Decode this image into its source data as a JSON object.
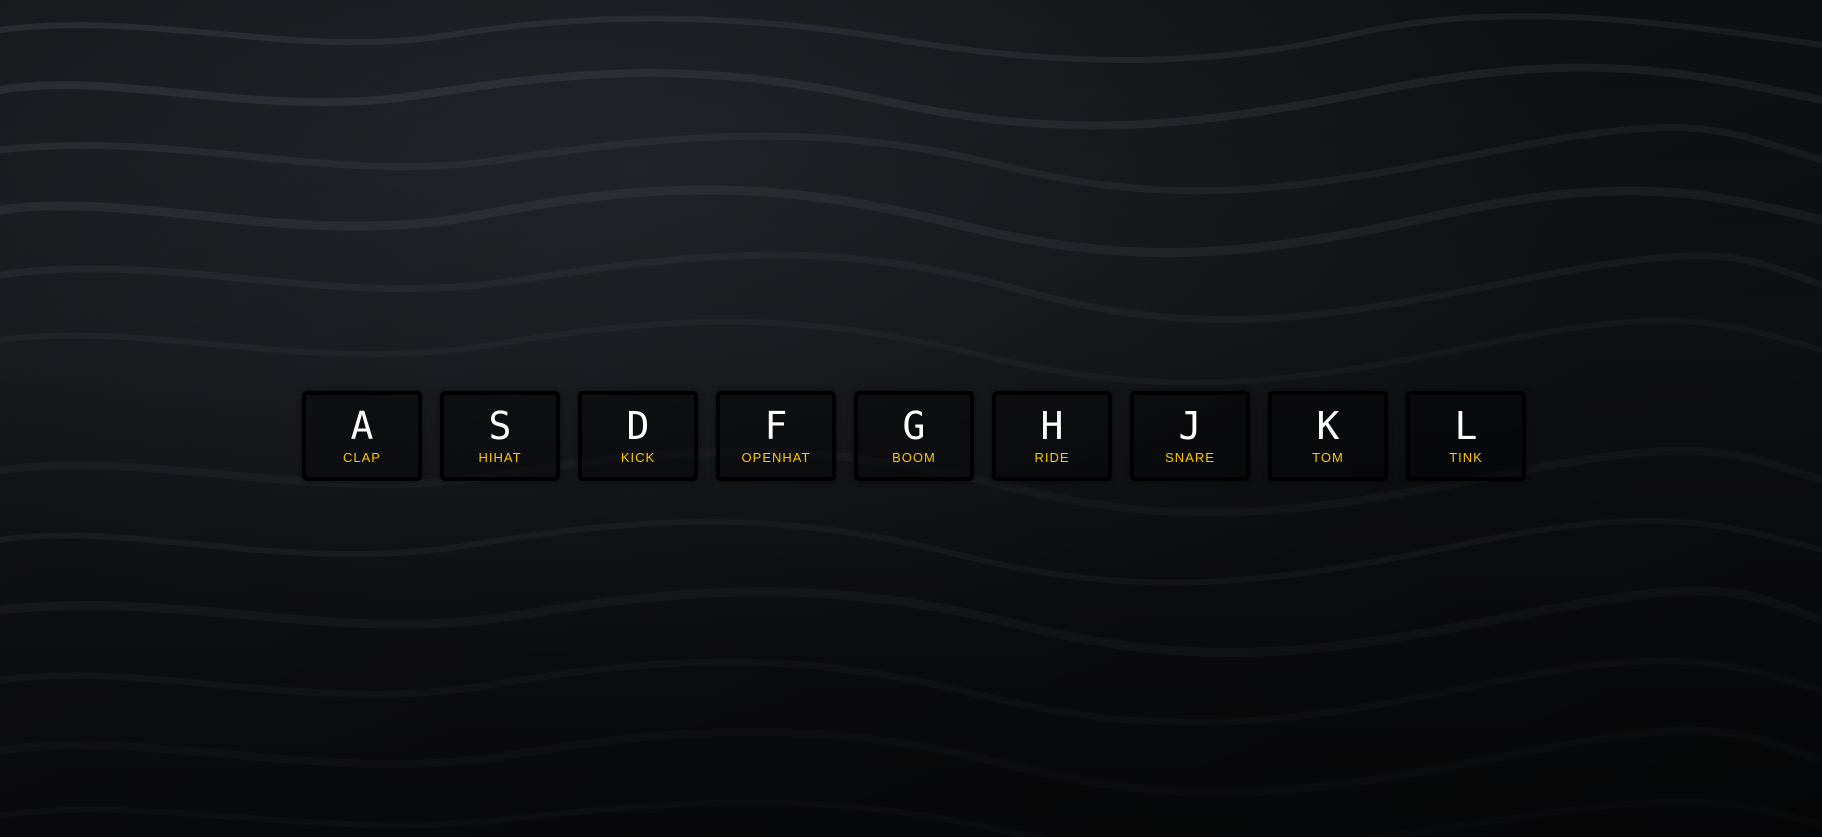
{
  "background": {
    "description_icon": "dark-water-waves-background",
    "base_color": "#15171a"
  },
  "accent_color": "#ffc600",
  "keys": [
    {
      "key": "A",
      "sound": "CLAP"
    },
    {
      "key": "S",
      "sound": "HIHAT"
    },
    {
      "key": "D",
      "sound": "KICK"
    },
    {
      "key": "F",
      "sound": "OPENHAT"
    },
    {
      "key": "G",
      "sound": "BOOM"
    },
    {
      "key": "H",
      "sound": "RIDE"
    },
    {
      "key": "J",
      "sound": "SNARE"
    },
    {
      "key": "K",
      "sound": "TOM"
    },
    {
      "key": "L",
      "sound": "TINK"
    }
  ]
}
